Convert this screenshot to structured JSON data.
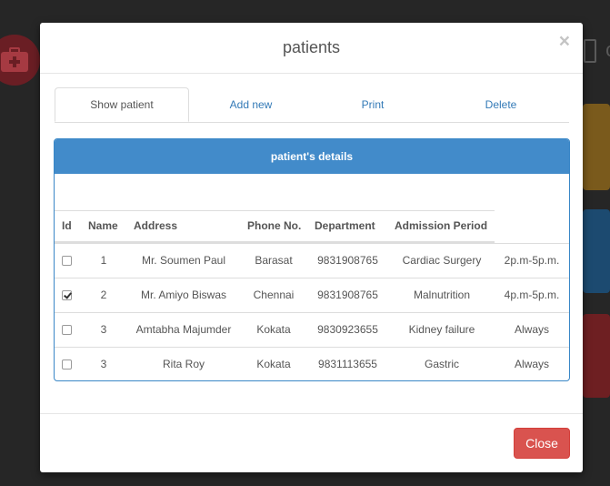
{
  "background": {
    "right_text": "c"
  },
  "modal": {
    "title": "patients",
    "close_x": "×",
    "tabs": [
      {
        "label": "Show patient",
        "active": true
      },
      {
        "label": "Add new",
        "active": false
      },
      {
        "label": "Print",
        "active": false
      },
      {
        "label": "Delete",
        "active": false
      }
    ],
    "panel_title": "patient's details",
    "table": {
      "headers": [
        "Id",
        "Name",
        "Address",
        "Phone No.",
        "Department",
        "Admission Period"
      ],
      "rows": [
        {
          "checked": false,
          "id": "1",
          "name": "Mr. Soumen Paul",
          "address": "Barasat",
          "phone": "9831908765",
          "department": "Cardiac Surgery",
          "period": "2p.m-5p.m."
        },
        {
          "checked": true,
          "id": "2",
          "name": "Mr. Amiyo Biswas",
          "address": "Chennai",
          "phone": "9831908765",
          "department": "Malnutrition",
          "period": "4p.m-5p.m."
        },
        {
          "checked": false,
          "id": "3",
          "name": "Amtabha Majumder",
          "address": "Kokata",
          "phone": "9830923655",
          "department": "Kidney failure",
          "period": "Always"
        },
        {
          "checked": false,
          "id": "3",
          "name": "Rita Roy",
          "address": "Kokata",
          "phone": "9831113655",
          "department": "Gastric",
          "period": "Always"
        }
      ]
    },
    "close_button": "Close"
  },
  "colors": {
    "primary": "#428bca",
    "danger": "#d9534f",
    "link": "#337ab7"
  }
}
